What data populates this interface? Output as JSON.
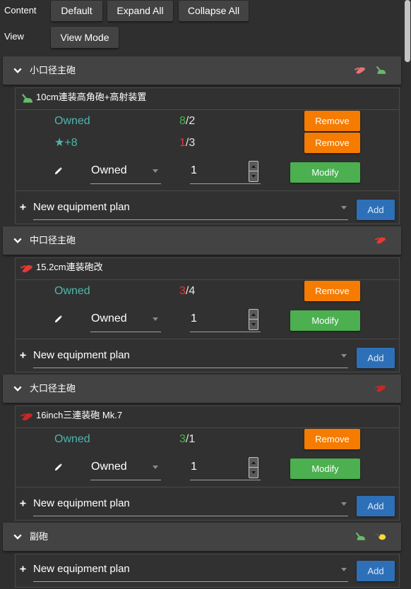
{
  "toolbar": {
    "content_label": "Content",
    "default_button": "Default",
    "expand_all_button": "Expand All",
    "collapse_all_button": "Collapse All",
    "view_label": "View",
    "view_mode_button": "View Mode"
  },
  "labels": {
    "count_separator": "/"
  },
  "colors": {
    "page_bg": "#2f2f2f",
    "header_bg": "#434343",
    "owned_text": "#4db6ac",
    "count_met": "#4caf50",
    "count_unmet": "#e53935",
    "remove_button": "#f57c00",
    "modify_button": "#4caf50",
    "add_button": "#2e70b8",
    "icon_small_main_gun": "#e57373",
    "icon_medium_main_gun": "#e53935",
    "icon_large_main_gun": "#c62828",
    "icon_high_angle_gun": "#66bb6a",
    "icon_secondary_gun": "#fdd835"
  },
  "groups": [
    {
      "title": "小口径主砲",
      "expanded": true,
      "icons": [
        "small-main-gun-icon",
        "high-angle-gun-icon"
      ],
      "equipment": [
        {
          "name": "10cm連装高角砲+高射装置",
          "icon": "high-angle-gun-icon",
          "entries": [
            {
              "label": "Owned",
              "count": 8,
              "required": 2,
              "requirement_met": true,
              "action": "Remove"
            },
            {
              "label": "★+8",
              "count": 1,
              "required": 3,
              "requirement_met": false,
              "action": "Remove"
            }
          ],
          "editor": {
            "selected": "Owned",
            "quantity": 1,
            "action": "Modify"
          }
        }
      ],
      "plan": {
        "placeholder": "New equipment plan",
        "action": "Add"
      }
    },
    {
      "title": "中口径主砲",
      "expanded": true,
      "icons": [
        "medium-main-gun-icon"
      ],
      "equipment": [
        {
          "name": "15.2cm連装砲改",
          "icon": "medium-main-gun-icon",
          "entries": [
            {
              "label": "Owned",
              "count": 3,
              "required": 4,
              "requirement_met": false,
              "action": "Remove"
            }
          ],
          "editor": {
            "selected": "Owned",
            "quantity": 1,
            "action": "Modify"
          }
        }
      ],
      "plan": {
        "placeholder": "New equipment plan",
        "action": "Add"
      }
    },
    {
      "title": "大口径主砲",
      "expanded": true,
      "icons": [
        "large-main-gun-icon"
      ],
      "equipment": [
        {
          "name": "16inch三連装砲 Mk.7",
          "icon": "large-main-gun-icon",
          "entries": [
            {
              "label": "Owned",
              "count": 3,
              "required": 1,
              "requirement_met": true,
              "action": "Remove"
            }
          ],
          "editor": {
            "selected": "Owned",
            "quantity": 1,
            "action": "Modify"
          }
        }
      ],
      "plan": {
        "placeholder": "New equipment plan",
        "action": "Add"
      }
    },
    {
      "title": "副砲",
      "expanded": true,
      "icons": [
        "high-angle-gun-icon",
        "secondary-gun-icon"
      ],
      "equipment": [],
      "plan": {
        "placeholder": "New equipment plan",
        "action": "Add"
      }
    }
  ]
}
